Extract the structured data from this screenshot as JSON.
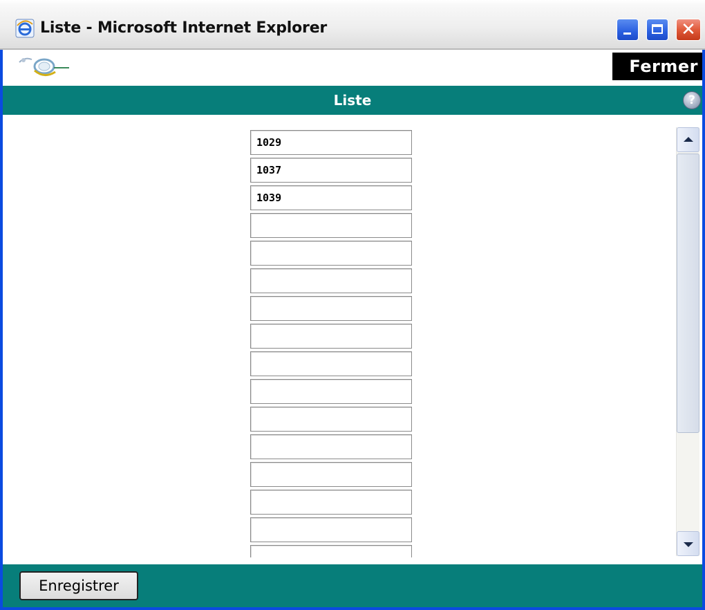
{
  "window": {
    "title": "Liste - Microsoft Internet Explorer",
    "icon": "ie-icon",
    "controls": [
      "minimize",
      "maximize",
      "close"
    ]
  },
  "toolbar": {
    "logo": "app-logo",
    "close_label": "Fermer"
  },
  "header": {
    "title": "Liste",
    "help_label": "?"
  },
  "list": {
    "values": [
      "1029",
      "1037",
      "1039",
      "",
      "",
      "",
      "",
      "",
      "",
      "",
      "",
      "",
      "",
      "",
      "",
      ""
    ]
  },
  "footer": {
    "save_label": "Enregistrer"
  },
  "colors": {
    "teal": "#077e7a",
    "window_border": "#0b4be0"
  }
}
